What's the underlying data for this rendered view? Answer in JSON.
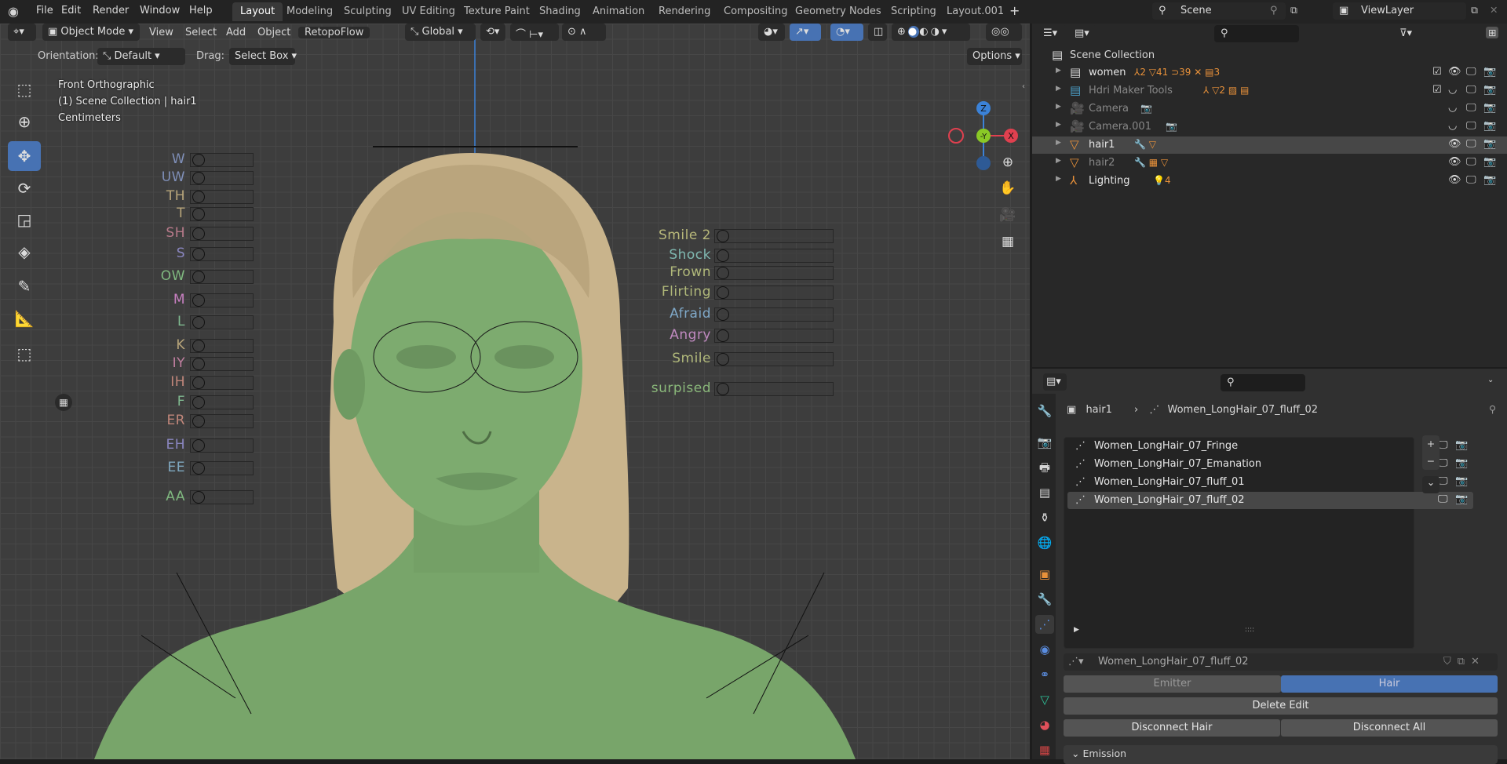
{
  "topbar": {
    "menus": [
      "File",
      "Edit",
      "Render",
      "Window",
      "Help"
    ],
    "workspaces": [
      "Layout",
      "Modeling",
      "Sculpting",
      "UV Editing",
      "Texture Paint",
      "Shading",
      "Animation",
      "Rendering",
      "Compositing",
      "Geometry Nodes",
      "Scripting",
      "Layout.001"
    ],
    "active_workspace": "Layout",
    "add_tab": "+",
    "scene": "Scene",
    "view_layer": "ViewLayer"
  },
  "viewport": {
    "mode": "Object Mode",
    "menus": [
      "View",
      "Select",
      "Add",
      "Object",
      "RetopoFlow"
    ],
    "transform": "Global",
    "orientation_label": "Orientation:",
    "orientation": "Default",
    "drag_label": "Drag:",
    "drag": "Select Box",
    "options": "Options",
    "overlay": [
      "Front Orthographic",
      "(1) Scene Collection | hair1",
      "Centimeters"
    ],
    "gizmo": {
      "z": "Z",
      "y": "-Y",
      "x": "X"
    },
    "colors": {
      "axis_x": "#e0404f",
      "axis_y": "#8ac926",
      "axis_z": "#3b82d8",
      "skin": "#78a56a",
      "hair": "#c9b48c",
      "active_tool": "#4772b3"
    },
    "shape_keys_left": [
      {
        "label": "W",
        "color": "#7f8fb8"
      },
      {
        "label": "UW",
        "color": "#7f8fb8"
      },
      {
        "label": "TH",
        "color": "#b8a57a"
      },
      {
        "label": "T",
        "color": "#b8a57a"
      },
      {
        "label": "SH",
        "color": "#b87a8a"
      },
      {
        "label": "S",
        "color": "#8a86c0"
      },
      {
        "label": "OW",
        "color": "#7fb87f"
      },
      {
        "label": "M",
        "color": "#c77fc0"
      },
      {
        "label": "L",
        "color": "#7fb88f"
      },
      {
        "label": "K",
        "color": "#b8a57a"
      },
      {
        "label": "IY",
        "color": "#c07fa0"
      },
      {
        "label": "IH",
        "color": "#c0867a"
      },
      {
        "label": "F",
        "color": "#7fb88f"
      },
      {
        "label": "ER",
        "color": "#c0867a"
      },
      {
        "label": "EH",
        "color": "#8a86c0"
      },
      {
        "label": "EE",
        "color": "#7fa8c0"
      },
      {
        "label": "AA",
        "color": "#7fb87f"
      }
    ],
    "shape_keys_right": [
      {
        "label": "Smile 2",
        "color": "#b8b87a"
      },
      {
        "label": "Shock",
        "color": "#7fb8b0"
      },
      {
        "label": "Frown",
        "color": "#b0b87a"
      },
      {
        "label": "Flirting",
        "color": "#b0b87a"
      },
      {
        "label": "Afraid",
        "color": "#7fa8c8"
      },
      {
        "label": "Angry",
        "color": "#c08ac0"
      },
      {
        "label": "Smile",
        "color": "#b0b87a"
      },
      {
        "label": "surpised",
        "color": "#8ab87a"
      }
    ]
  },
  "outliner": {
    "root": "Scene Collection",
    "rows": [
      {
        "name": "women",
        "icon": "collection-icon",
        "badges": "⅄2 ▽41 ⊃39 ✕ ▤3",
        "check": true,
        "eye": "👁",
        "dim": false,
        "selected": false
      },
      {
        "name": "Hdri Maker Tools",
        "icon": "collection-icon",
        "badges": "⅄ ▽2 ▨ ▤",
        "check": true,
        "eye": "◡",
        "dim": true,
        "selected": false
      },
      {
        "name": "Camera",
        "icon": "camera-icon",
        "badges": "📷",
        "check": false,
        "eye": "◡",
        "dim": true,
        "selected": false
      },
      {
        "name": "Camera.001",
        "icon": "camera-icon",
        "badges": "📷",
        "check": false,
        "eye": "◡",
        "dim": true,
        "selected": false
      },
      {
        "name": "hair1",
        "icon": "mesh-icon",
        "badges": "🔧 ▽",
        "check": false,
        "eye": "👁",
        "dim": false,
        "selected": true
      },
      {
        "name": "hair2",
        "icon": "mesh-icon",
        "badges": "🔧 ▦ ▽",
        "check": false,
        "eye": "👁",
        "dim": true,
        "selected": false
      },
      {
        "name": "Lighting",
        "icon": "empty-icon",
        "badges": "💡4",
        "check": false,
        "eye": "👁",
        "dim": false,
        "selected": false
      }
    ]
  },
  "properties": {
    "breadcrumb_object": "hair1",
    "breadcrumb_psys": "Women_LongHair_07_fluff_02",
    "particle_systems": [
      "Women_LongHair_07_Fringe",
      "Women_LongHair_07_Emanation",
      "Women_LongHair_07_fluff_01",
      "Women_LongHair_07_fluff_02"
    ],
    "active_index": 3,
    "settings_name": "Women_LongHair_07_fluff_02",
    "type_options": [
      "Emitter",
      "Hair"
    ],
    "type_selected": "Hair",
    "delete_edit": "Delete Edit",
    "disconnect_hair": "Disconnect Hair",
    "disconnect_all": "Disconnect All",
    "emission_panel": "Emission"
  }
}
